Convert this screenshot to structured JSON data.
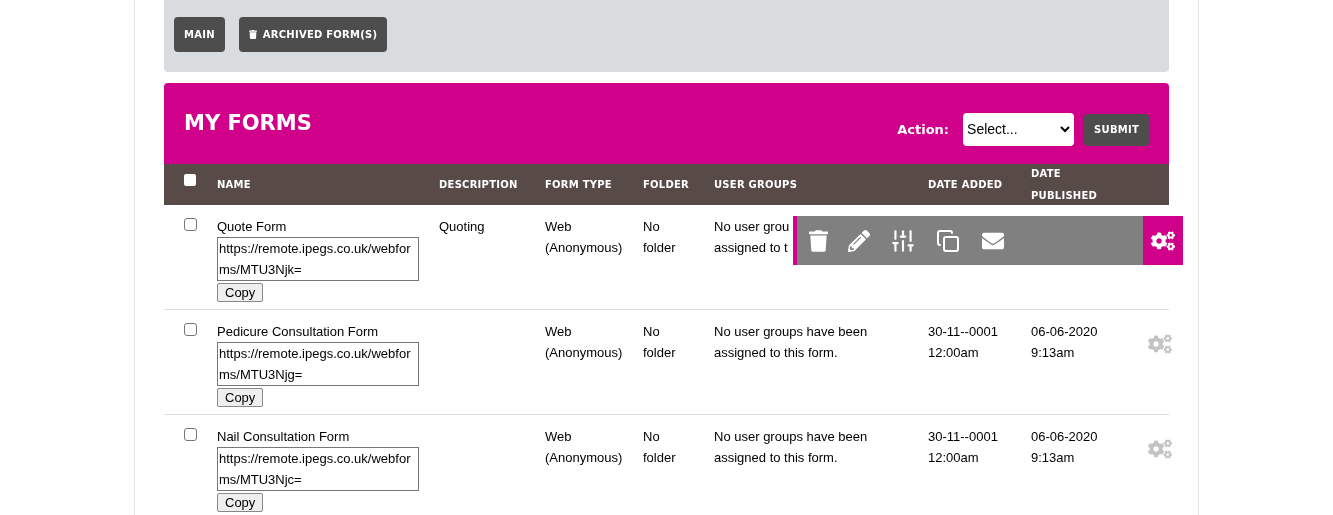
{
  "folders": {
    "buttons": [
      {
        "label": "MAIN",
        "icon": false
      },
      {
        "label": "ARCHIVED FORM(S)",
        "icon": true
      }
    ]
  },
  "forms_panel": {
    "title": "MY FORMS",
    "action_label": "Action:",
    "action_select": "Select...",
    "submit": "SUBMIT"
  },
  "table": {
    "columns": [
      "NAME",
      "DESCRIPTION",
      "FORM TYPE",
      "FOLDER",
      "USER GROUPS",
      "DATE ADDED",
      "DATE PUBLISHED"
    ],
    "header_checked": false,
    "rows": [
      {
        "checked": false,
        "name": "Quote Form",
        "url": "https://remote.ipegs.co.uk/webforms/MTU3Njk=",
        "copy": "Copy",
        "description": "Quoting",
        "form_type": "Web (Anonymous)",
        "folder": "No folder",
        "user_groups": [
          "No user grou",
          "assigned to t"
        ],
        "actions_open": true
      },
      {
        "checked": false,
        "name": "Pedicure Consultation Form",
        "url": "https://remote.ipegs.co.uk/webforms/MTU3Njg=",
        "copy": "Copy",
        "form_type": "Web (Anonymous)",
        "folder": "No folder",
        "user_groups": [
          "No user groups have been",
          "assigned to this form."
        ],
        "date_added": [
          "30-11--0001",
          "12:00am"
        ],
        "date_published": [
          "06-06-2020",
          "9:13am"
        ],
        "actions_open": false
      },
      {
        "checked": false,
        "name": "Nail Consultation Form",
        "url": "https://remote.ipegs.co.uk/webforms/MTU3Njc=",
        "copy": "Copy",
        "form_type": "Web (Anonymous)",
        "folder": "No folder",
        "user_groups": [
          "No user groups have been",
          "assigned to this form."
        ],
        "date_added": [
          "30-11--0001",
          "12:00am"
        ],
        "date_published": [
          "06-06-2020",
          "9:13am"
        ],
        "actions_open": false
      }
    ]
  }
}
